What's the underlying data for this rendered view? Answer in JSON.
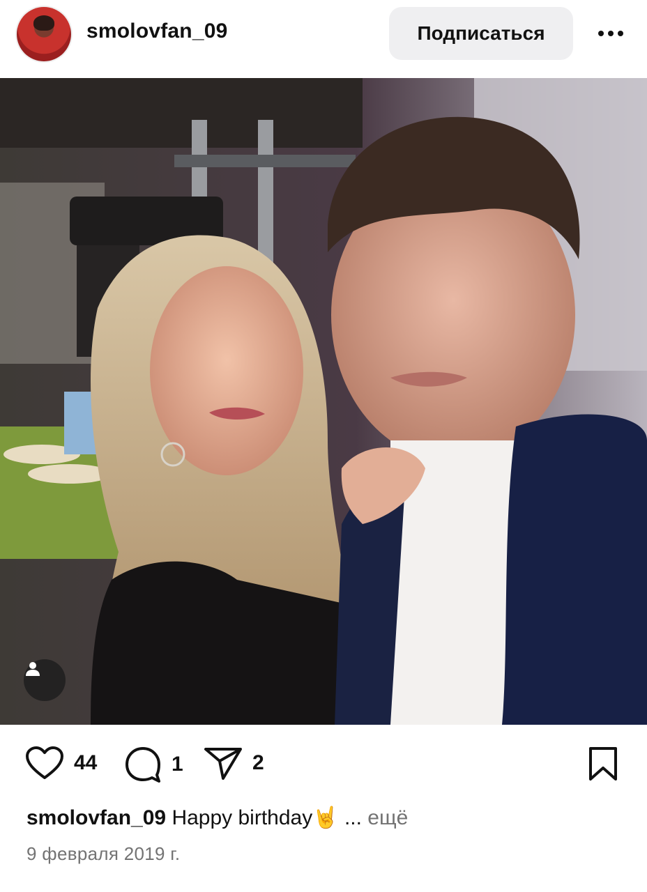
{
  "header": {
    "username": "smolovfan_09",
    "follow_label": "Подписаться",
    "more_icon": "more-horizontal-icon"
  },
  "post": {
    "image_alt_icon": "user-tag-icon",
    "likes": "44",
    "comments": "1",
    "shares": "2",
    "icons": [
      "heart-icon",
      "comment-icon",
      "send-icon",
      "bookmark-icon"
    ]
  },
  "caption": {
    "username": "smolovfan_09",
    "text": "Happy birthday",
    "emoji": "🤘",
    "ellipsis": "...",
    "more_label": "ещё"
  },
  "date": "9 февраля 2019 г."
}
